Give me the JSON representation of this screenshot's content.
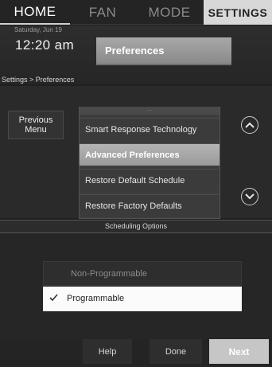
{
  "tabs": [
    {
      "label": "HOME"
    },
    {
      "label": "FAN"
    },
    {
      "label": "MODE"
    },
    {
      "label": "SETTINGS"
    }
  ],
  "header": {
    "date": "Saturday, Jun 19",
    "time": "12:20 am",
    "title_button": "Preferences"
  },
  "breadcrumb": "Settings > Preferences",
  "menu": {
    "previous_label": "Previous Menu",
    "partial_item": "...",
    "items": [
      {
        "label": "Smart Response Technology"
      },
      {
        "label": "Advanced Preferences"
      },
      {
        "label": "Restore Default Schedule"
      },
      {
        "label": "Restore Factory Defaults"
      }
    ],
    "selected_index": 1
  },
  "icons": {
    "scroll_up": "chevron-up-icon",
    "scroll_down": "chevron-down-icon",
    "check": "checkmark-icon"
  },
  "scheduling": {
    "title": "Scheduling Options",
    "options": [
      {
        "label": "Non-Programmable",
        "selected": false
      },
      {
        "label": "Programmable",
        "selected": true
      }
    ]
  },
  "footer": {
    "help": "Help",
    "done": "Done",
    "next": "Next"
  },
  "colors": {
    "background": "#1f1f1f",
    "selected_item": "#a8a8a8",
    "selected_option": "#fbfbfb",
    "settings_tab": "#d8d8d8"
  }
}
